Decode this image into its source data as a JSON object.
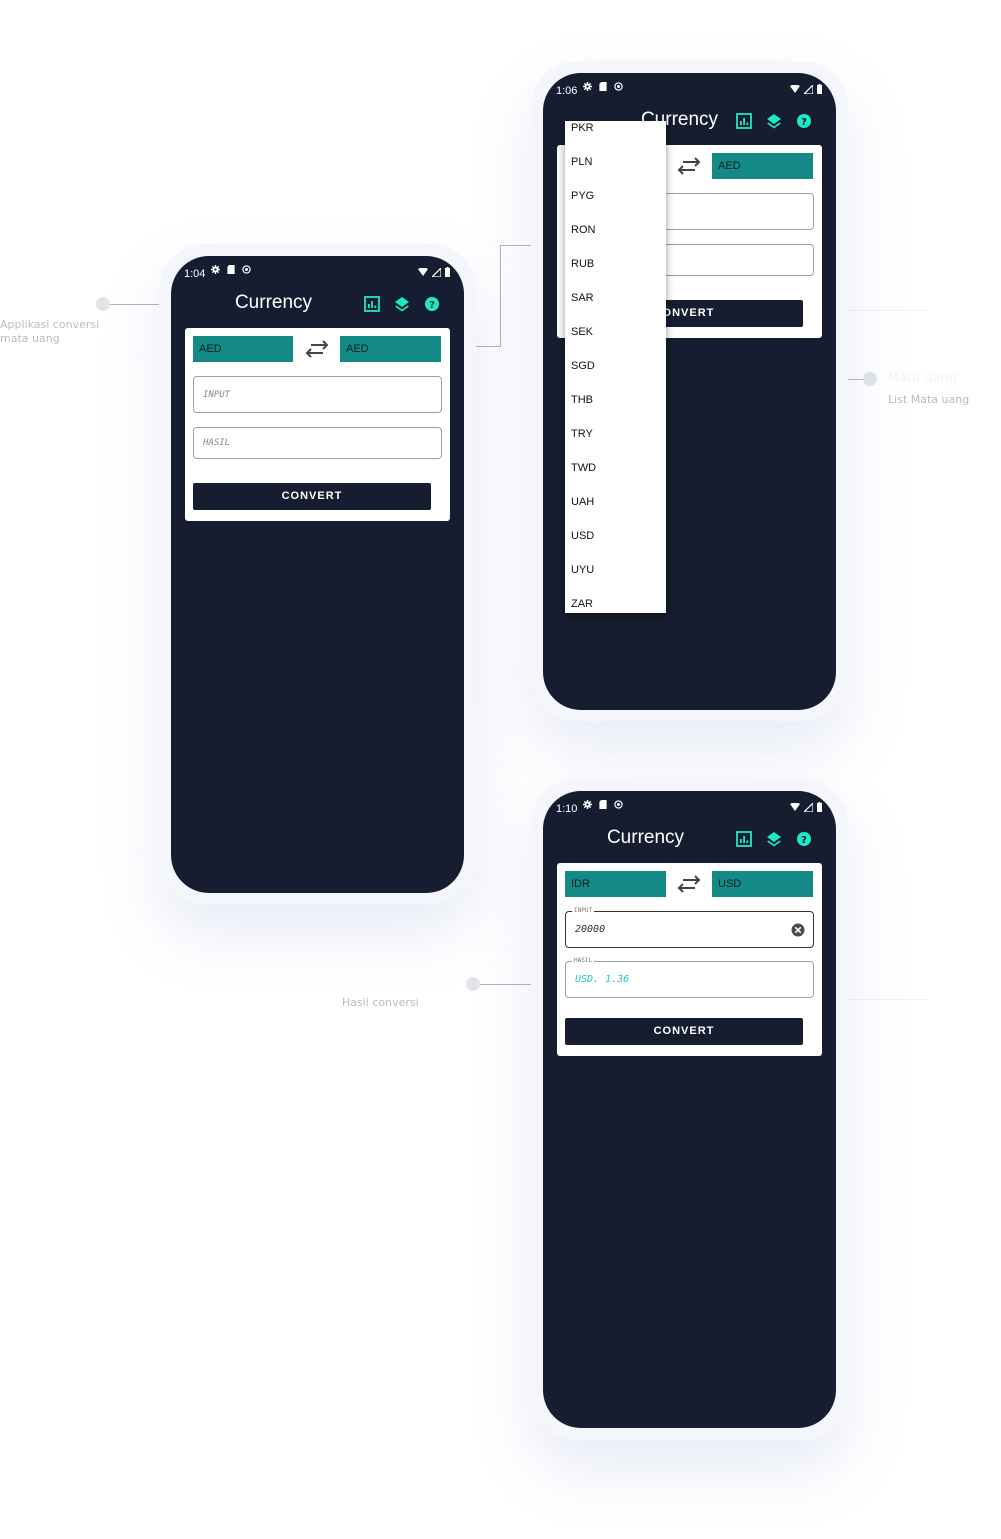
{
  "annotations": {
    "app_desc_line1": "Applikasi conversi",
    "app_desc_line2": "mata uang",
    "list_title": "Mata uang",
    "list_desc": "List Mata uang",
    "result_desc": "Hasil conversi"
  },
  "screen1": {
    "time": "1:04",
    "title": "Currency",
    "from_currency": "AED",
    "to_currency": "AED",
    "input_placeholder": "INPUT",
    "result_placeholder": "HASIL",
    "convert_label": "CONVERT"
  },
  "screen2": {
    "time": "1:06",
    "title": "Currency",
    "to_currency": "AED",
    "convert_label": "CONVERT",
    "dropdown_items": [
      "PKR",
      "PLN",
      "PYG",
      "RON",
      "RUB",
      "SAR",
      "SEK",
      "SGD",
      "THB",
      "TRY",
      "TWD",
      "UAH",
      "USD",
      "UYU",
      "ZAR"
    ]
  },
  "screen3": {
    "time": "1:10",
    "title": "Currency",
    "from_currency": "IDR",
    "to_currency": "USD",
    "input_label": "INPUT",
    "input_value": "20000",
    "result_label": "HASIL",
    "result_value": "USD. 1.36",
    "convert_label": "CONVERT"
  },
  "colors": {
    "background": "#161d30",
    "accent": "#1de9c8",
    "currency_box": "#138a86",
    "card": "#ffffff"
  },
  "icons": [
    "settings-icon",
    "sd-card-icon",
    "sync-icon",
    "wifi-icon",
    "signal-icon",
    "battery-icon",
    "chart-icon",
    "layers-icon",
    "help-icon",
    "swap-icon",
    "clear-icon"
  ]
}
